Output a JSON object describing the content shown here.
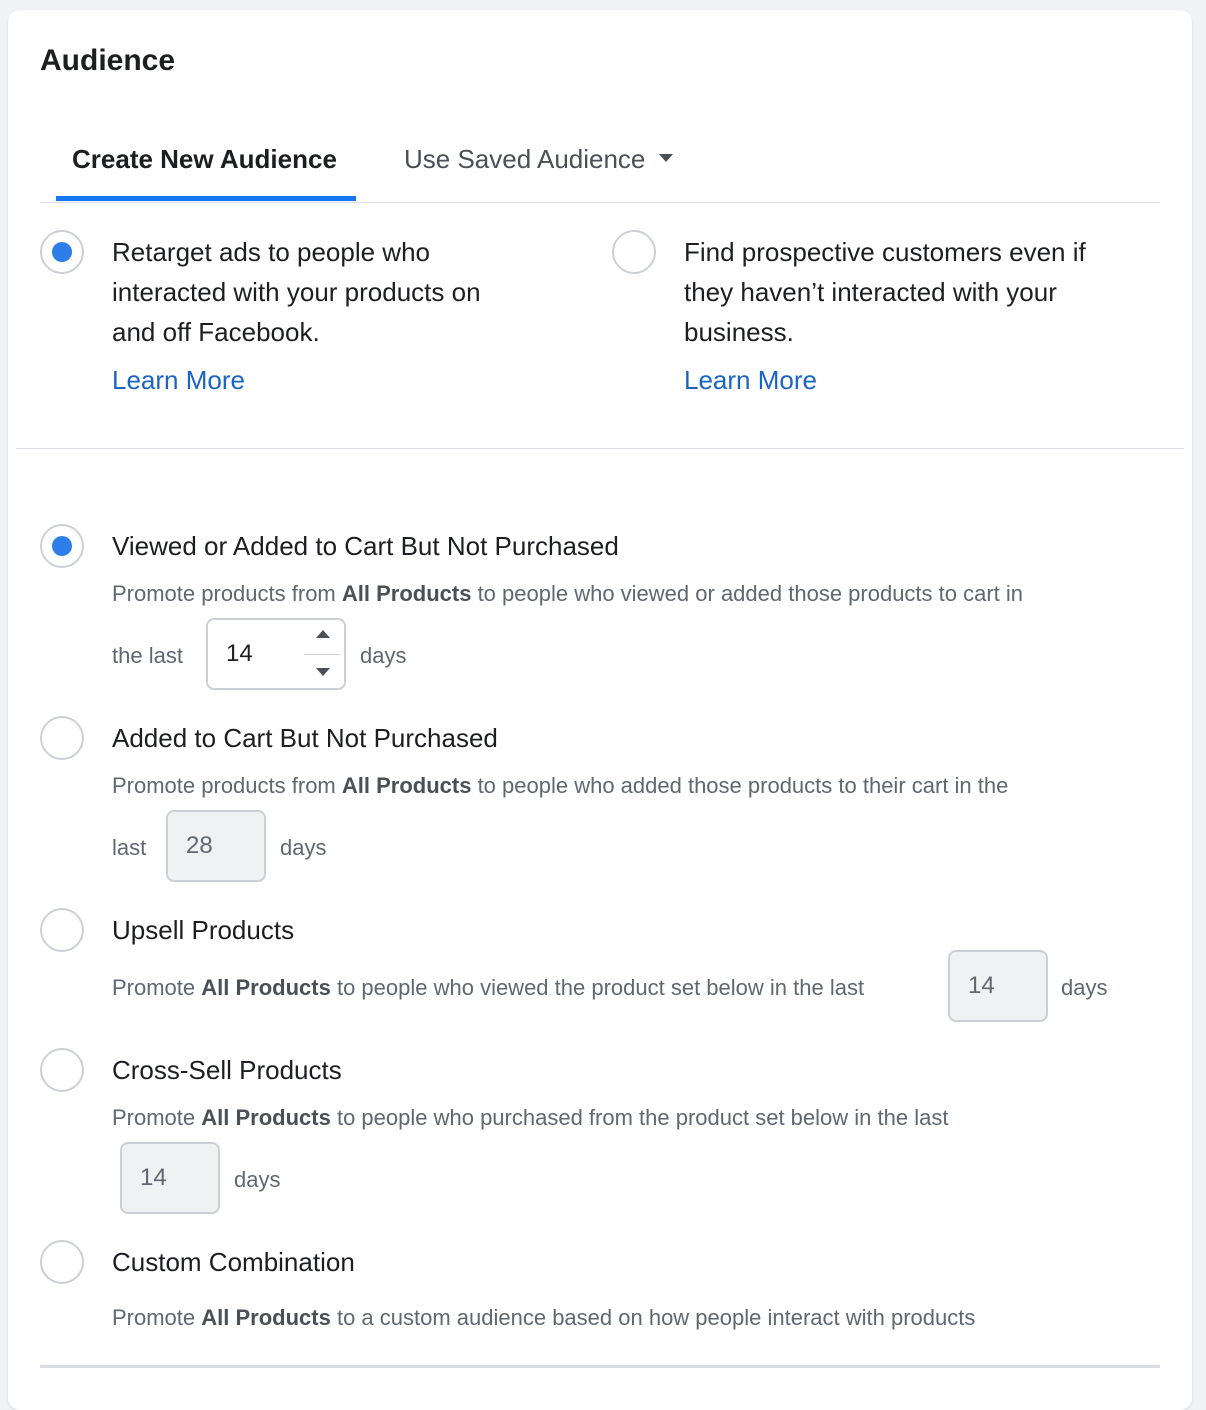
{
  "title": "Audience",
  "tabs": [
    {
      "label": "Create New Audience",
      "active": true
    },
    {
      "label": "Use Saved Audience",
      "active": false
    }
  ],
  "colors": {
    "accent": "#1877f2",
    "radio": "#2d7ee8",
    "link": "#1a64c8"
  },
  "strategies": [
    {
      "text_lines": [
        "Retarget ads to people who",
        "interacted with your products on",
        "and off Facebook."
      ],
      "link": "Learn More",
      "selected": true
    },
    {
      "text_lines": [
        "Find prospective customers even if",
        "they haven’t interacted with your",
        "business."
      ],
      "link": "Learn More",
      "selected": false
    }
  ],
  "options": [
    {
      "title": "Viewed or Added to Cart But Not Purchased",
      "selected": true,
      "desc_line1_pre": "Promote products from ",
      "desc_bold": "All Products",
      "desc_line1_post": " to people who viewed or added those products to cart in",
      "desc_line2_pre": "the last",
      "days_value": "14",
      "days_label": "days"
    },
    {
      "title": "Added to Cart But Not Purchased",
      "selected": false,
      "desc_line1_pre": "Promote products from ",
      "desc_bold": "All Products",
      "desc_line1_post": " to people who added those products to their cart in the",
      "desc_line2_pre": "last",
      "days_value": "28",
      "days_label": "days"
    },
    {
      "title": "Upsell Products",
      "selected": false,
      "desc_line1_pre": "Promote ",
      "desc_bold": "All Products",
      "desc_line1_post": " to people who viewed the product set below in the last",
      "days_value": "14",
      "days_label": "days"
    },
    {
      "title": "Cross-Sell Products",
      "selected": false,
      "desc_line1_pre": "Promote ",
      "desc_bold": "All Products",
      "desc_line1_post": " to people who purchased from the product set below in the last",
      "days_value": "14",
      "days_label": "days"
    },
    {
      "title": "Custom Combination",
      "selected": false,
      "desc_line1_pre": "Promote ",
      "desc_bold": "All Products",
      "desc_line1_post": " to a custom audience based on how people interact with products"
    }
  ]
}
